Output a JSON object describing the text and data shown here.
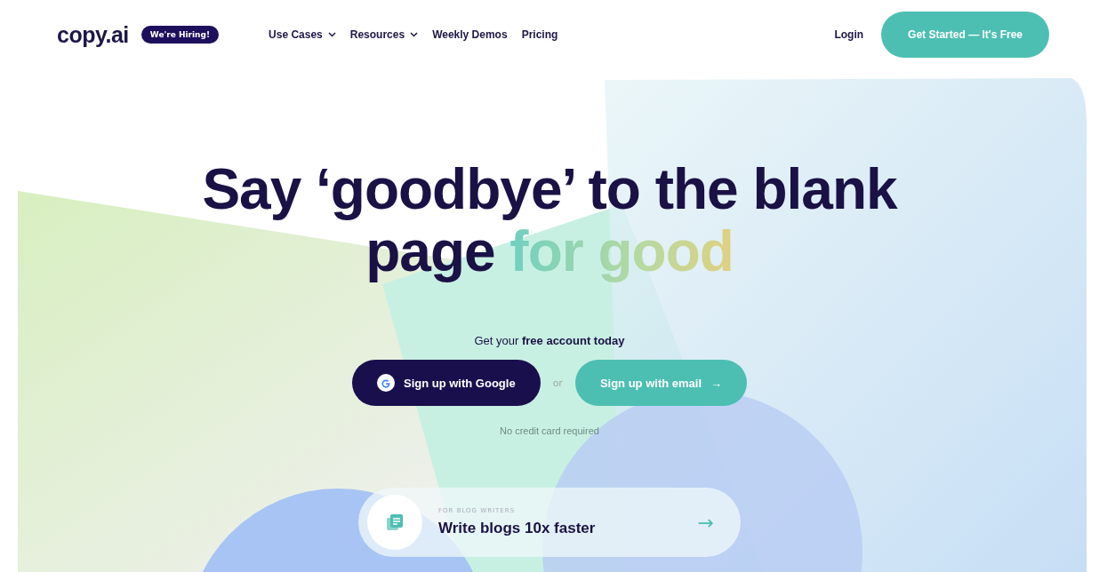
{
  "header": {
    "logo": "copy.ai",
    "badge": "We're Hiring!",
    "nav": [
      {
        "label": "Use Cases",
        "dropdown": true
      },
      {
        "label": "Resources",
        "dropdown": true
      },
      {
        "label": "Weekly Demos",
        "dropdown": false
      },
      {
        "label": "Pricing",
        "dropdown": false
      }
    ],
    "login": "Login",
    "cta": "Get Started — It's Free"
  },
  "hero": {
    "headline": "Say ‘goodbye’ to the blank page",
    "highlight": "for good",
    "subtitle": "Get your **free account today**",
    "google_button": "Sign up with Google",
    "separator": "or",
    "email_button": "Sign up with email",
    "email_arrow": "→",
    "note": "No credit card required"
  },
  "feature_card": {
    "eyebrow": "FOR BLOG WRITERS",
    "title": "Write blogs 10x faster",
    "arrow": "→"
  }
}
